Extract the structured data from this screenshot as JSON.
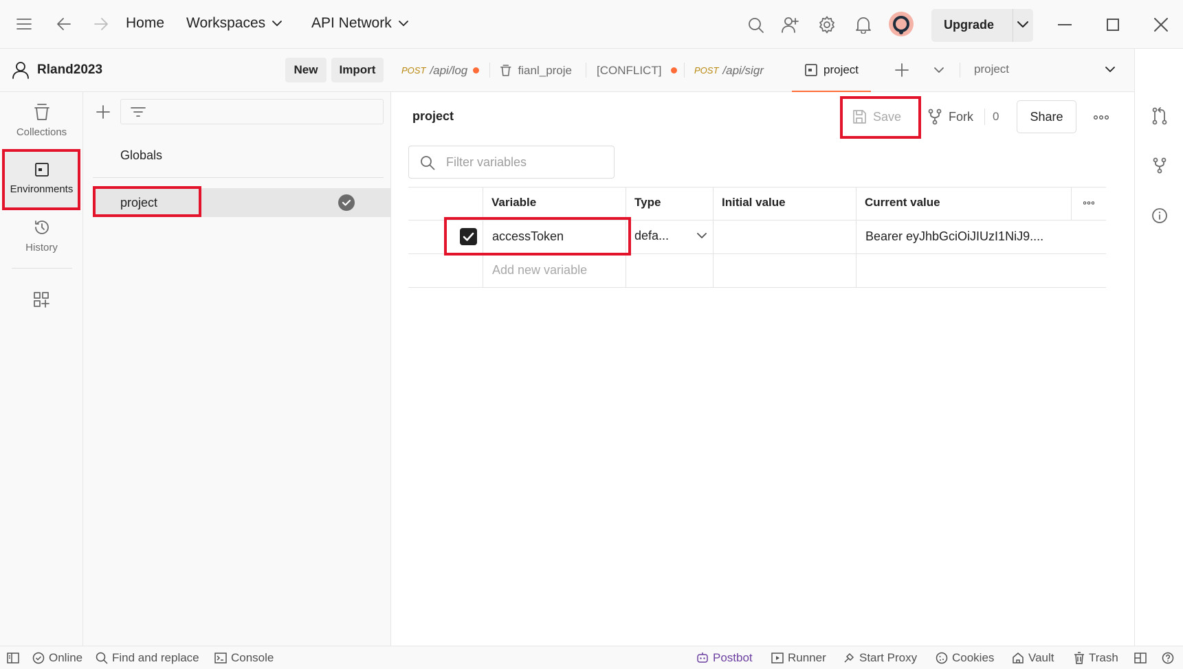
{
  "topbar": {
    "home": "Home",
    "workspaces": "Workspaces",
    "api_network": "API Network",
    "upgrade": "Upgrade"
  },
  "workspace": {
    "name": "Rland2023",
    "new_label": "New",
    "import_label": "Import"
  },
  "tabs": [
    {
      "method": "POST",
      "label": "/api/log"
    },
    {
      "label": "fianl_proje"
    },
    {
      "label": "[CONFLICT]"
    },
    {
      "method": "POST",
      "label": "/api/sigr"
    },
    {
      "label": "project"
    }
  ],
  "environment_selector": "project",
  "rail": {
    "collections": "Collections",
    "environments": "Environments",
    "history": "History"
  },
  "sidebar": {
    "globals": "Globals",
    "project": "project"
  },
  "main": {
    "title": "project",
    "save": "Save",
    "fork": "Fork",
    "fork_count": "0",
    "share": "Share",
    "filter_placeholder": "Filter variables"
  },
  "table": {
    "headers": {
      "variable": "Variable",
      "type": "Type",
      "initial": "Initial value",
      "current": "Current value"
    },
    "rows": [
      {
        "variable": "accessToken",
        "type": "defa...",
        "initial": "",
        "current": "Bearer eyJhbGciOiJIUzI1NiJ9...."
      }
    ],
    "add_placeholder": "Add new variable"
  },
  "status": {
    "online": "Online",
    "find_replace": "Find and replace",
    "console": "Console",
    "postbot": "Postbot",
    "runner": "Runner",
    "start_proxy": "Start Proxy",
    "cookies": "Cookies",
    "vault": "Vault",
    "trash": "Trash"
  },
  "colors": {
    "accent": "#ff6c37",
    "highlight_box": "#e3132c",
    "postbot": "#6b3fa0"
  }
}
